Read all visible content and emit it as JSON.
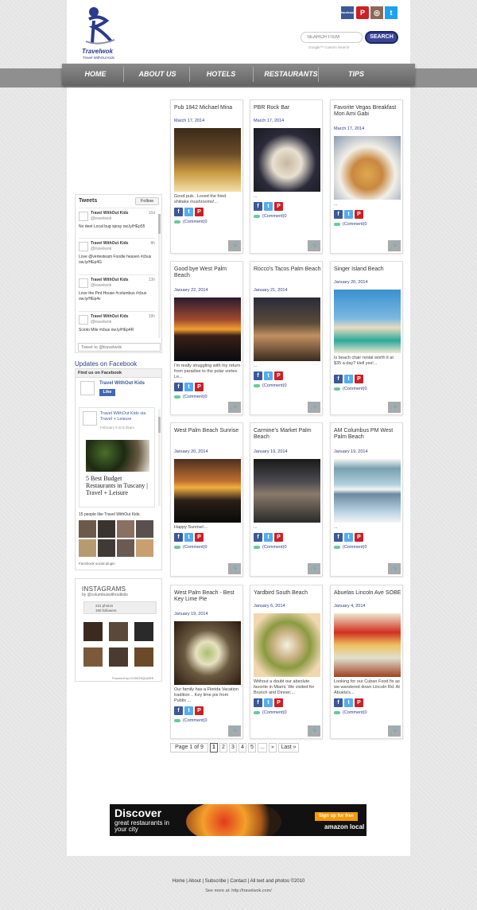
{
  "brand": {
    "name": "Travelwok",
    "tagline": "Travel WithOut Kids"
  },
  "social": {
    "facebook": "facebook",
    "pinterest": "P",
    "instagram": "◎",
    "twitter": "t"
  },
  "search": {
    "placeholder": "SEARCH ITEM",
    "button": "SEARCH",
    "powered": "Google™ Custom Search"
  },
  "nav": [
    {
      "label": "HOME"
    },
    {
      "label": "ABOUT US"
    },
    {
      "label": "HOTELS"
    },
    {
      "label": "RESTAURANTS"
    },
    {
      "label": "TIPS"
    }
  ],
  "twitter_widget": {
    "heading": "Tweets",
    "follow": "Follow",
    "input_placeholder": "Tweet to @travelwok",
    "tweets": [
      {
        "name": "Travel WithOut Kids",
        "handle": "@travelwok",
        "time": "16d",
        "text": "No deet Local bug spray ow.ly/HEp55"
      },
      {
        "name": "Travel WithOut Kids",
        "handle": "@travelwok",
        "time": "8h",
        "text": "Love @vertesteam Foodie heaven #cbus ow.ly/HEp4G"
      },
      {
        "name": "Travel WithOut Kids",
        "handle": "@travelwok",
        "time": "13h",
        "text": "Love the Pint House #columbus #cbus ow.ly/HEp4v"
      },
      {
        "name": "Travel WithOut Kids",
        "handle": "@travelwok",
        "time": "18h",
        "text": "Scioto Mile #cbus ow.ly/HEp4R"
      }
    ]
  },
  "facebook_widget": {
    "section_title": "Updates on Facebook",
    "header": "Find us on Facebook",
    "page_name": "Travel WithOut Kids",
    "like": "Like",
    "post_meta": "Travel WithOut Kids via Travel + Leisure",
    "post_date": "February 5 at 6:35am",
    "post_title": "5 Best Budget Restaurants in Tuscany | Travel + Leisure",
    "people_like": "15 people like Travel WithOut Kids.",
    "plugin": "Facebook social plugin"
  },
  "instagram_widget": {
    "title": "INSTAGRAMS",
    "handle": "by @columbuswithoutkids",
    "photos": "231 photos",
    "followers": "190 followers",
    "powered": "Powered by ICONOSQUARE"
  },
  "posts": [
    {
      "title": "Pub 1842 Michael Mina",
      "date": "March 17, 2014",
      "excerpt": "Good pub.. Loved the fried shiitake mushrooms!...",
      "comments": "(Comment)0"
    },
    {
      "title": "PBR Rock Bar",
      "date": "March 17, 2014",
      "excerpt": "...",
      "comments": "(Comment)0"
    },
    {
      "title": "Favorite Vegas Breakfast Mon Ami Gabi",
      "date": "March 17, 2014",
      "excerpt": "...",
      "comments": "(Comment)0"
    },
    {
      "title": "Good bye West Palm Beach",
      "date": "January 22, 2014",
      "excerpt": "I'm really struggling with my return from paradise to the polar vortex. Le...",
      "comments": "(Comment)0"
    },
    {
      "title": "Rocco's Tacos Palm Beach",
      "date": "January 21, 2014",
      "excerpt": "...",
      "comments": "(Comment)0"
    },
    {
      "title": "Singer Island Beach",
      "date": "January 20, 2014",
      "excerpt": "Is beach chair rental worth it at $35 a day? Hell yes!...",
      "comments": "(Comment)0"
    },
    {
      "title": "West Palm Beach Sunrise",
      "date": "January 20, 2014",
      "excerpt": "Happy Sunrise!...",
      "comments": "(Comment)0"
    },
    {
      "title": "Carmine's Market Palm Beach",
      "date": "January 19, 2014",
      "excerpt": "...",
      "comments": "(Comment)0"
    },
    {
      "title": "AM Columbus PM West Palm Beach",
      "date": "January 19, 2014",
      "excerpt": "...",
      "comments": "(Comment)0"
    },
    {
      "title": "West Palm Beach - Best Key Lime Pie",
      "date": "January 19, 2014",
      "excerpt": "Our family has a Florida Vacation tradition .. Key lime pie from Publix ...",
      "comments": "(Comment)0"
    },
    {
      "title": "Yardbird South Beach",
      "date": "January 6, 2014",
      "excerpt": "Without a doubt our absolute favorite in Miami. We visited for Brunch and Dinner;...",
      "comments": "(Comment)0"
    },
    {
      "title": "Abuelas Lincoln Ave SOBE",
      "date": "January 4, 2014",
      "excerpt": "Looking for our Cuban Food fix as we wandered down Lincoln Rd. At Abuela's...",
      "comments": "(Comment)0"
    }
  ],
  "pagination": {
    "summary": "Page 1 of 9",
    "pages": [
      "1",
      "2",
      "3",
      "4",
      "5"
    ],
    "ellipsis": "...",
    "next": "»",
    "last": "Last »"
  },
  "ad": {
    "headline": "Discover",
    "sub": "great restaurants in your city",
    "cta": "Sign up for free",
    "brand": "amazon local"
  },
  "footer": {
    "links": [
      "Home",
      "About",
      "Subscribe",
      "Contact",
      "All text and photos ©2010"
    ],
    "more": "See more at: http://travelwok.com/"
  },
  "colors": {
    "brand": "#2b3a8c",
    "nav": "#777777",
    "facebook": "#3b5998",
    "twitter": "#55acee",
    "pinterest": "#cb2027"
  }
}
